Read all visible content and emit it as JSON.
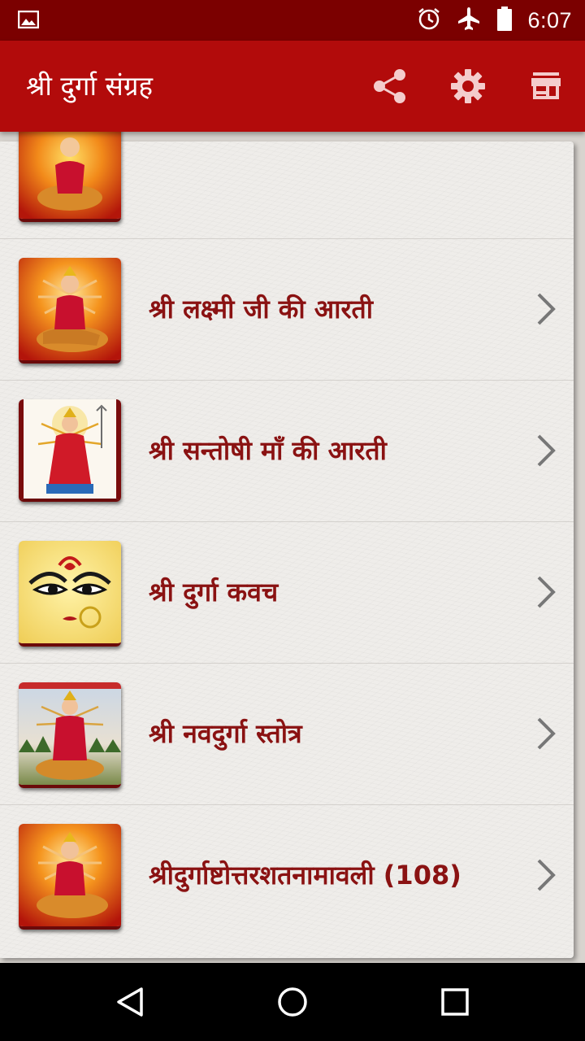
{
  "status_bar": {
    "time": "6:07",
    "icons": [
      "image-notification-icon",
      "alarm-icon",
      "airplane-mode-icon",
      "battery-icon"
    ]
  },
  "app_bar": {
    "title": "श्री दुर्गा संग्रह",
    "actions": [
      "share-icon",
      "settings-gear-icon",
      "store-icon"
    ],
    "color": "#b20b0b"
  },
  "list": {
    "items": [
      {
        "label": "",
        "thumb": "durga-tiger"
      },
      {
        "label": "श्री लक्ष्मी जी की आरती",
        "thumb": "durga-tiger"
      },
      {
        "label": "श्री सन्तोषी माँ की आरती",
        "thumb": "santoshi-maa"
      },
      {
        "label": "श्री दुर्गा कवच",
        "thumb": "durga-face"
      },
      {
        "label": "श्री नवदुर्गा स्तोत्र",
        "thumb": "navdurga"
      },
      {
        "label": "श्रीदुर्गाष्टोत्तरशतनामावली (108)",
        "thumb": "durga-tiger"
      }
    ],
    "label_color": "#8a1212"
  },
  "nav_bar": {
    "buttons": [
      "back-icon",
      "home-icon",
      "recents-icon"
    ]
  }
}
